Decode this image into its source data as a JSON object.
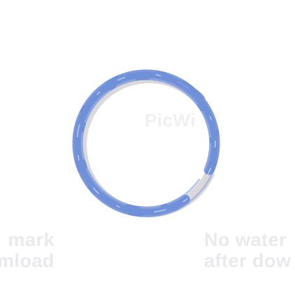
{
  "image": {
    "subject": "brush-stroke-circle",
    "colors": {
      "stroke": "#7090d8",
      "stroke_light": "#8fa7e2",
      "shadow": "#c9c6c8",
      "background": "#ffffff",
      "watermark": "#e9e9ee"
    }
  },
  "watermarks": {
    "center": "PicWi",
    "bottom_left": [
      "mark",
      "mload"
    ],
    "bottom_right": [
      "No water",
      "after dow"
    ]
  }
}
